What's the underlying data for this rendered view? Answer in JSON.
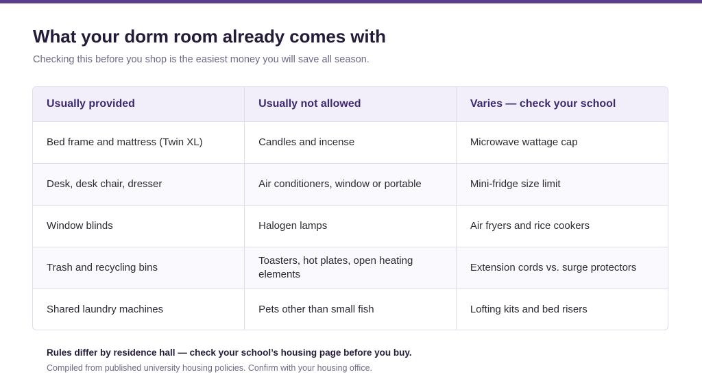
{
  "header": {
    "title": "What your dorm room already comes with",
    "subtitle": "Checking this before you shop is the easiest money you will save all season."
  },
  "table": {
    "columns": [
      "Usually provided",
      "Usually not allowed",
      "Varies — check your school"
    ],
    "rows": [
      [
        "Bed frame and mattress (Twin XL)",
        "Candles and incense",
        "Microwave wattage cap"
      ],
      [
        "Desk, desk chair, dresser",
        "Air conditioners, window or portable",
        "Mini-fridge size limit"
      ],
      [
        "Window blinds",
        "Halogen lamps",
        "Air fryers and rice cookers"
      ],
      [
        "Trash and recycling bins",
        "Toasters, hot plates, open heating elements",
        "Extension cords vs. surge protectors"
      ],
      [
        "Shared laundry machines",
        "Pets other than small fish",
        "Lofting kits and bed risers"
      ]
    ]
  },
  "footer": {
    "note": "Rules differ by residence hall — check your school’s housing page before you buy.",
    "source": "Compiled from published university housing policies. Confirm with your housing office."
  },
  "colors": {
    "accent": "#5b3f8f",
    "header_bg": "#f2effb",
    "header_text": "#3e2a6e",
    "border": "#e0dcec"
  }
}
